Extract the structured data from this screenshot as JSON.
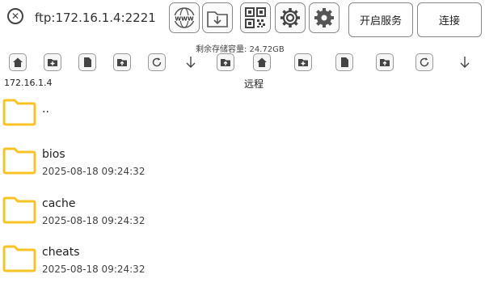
{
  "header": {
    "address": "ftp:172.16.1.4:2221",
    "start_service_label": "开启服务",
    "connect_label": "连接",
    "storage_text": "剩余存储容量: 24.72GB",
    "tool_icons": [
      "www-icon",
      "folder-download-icon",
      "qr-code-icon",
      "settings-outline-icon",
      "settings-filled-icon"
    ]
  },
  "local": {
    "label": "172.16.1.4"
  },
  "remote": {
    "label": "远程"
  },
  "files": [
    {
      "name": "..",
      "date": ""
    },
    {
      "name": "bios",
      "date": "2025-08-18 09:24:32"
    },
    {
      "name": "cache",
      "date": "2025-08-18 09:24:32"
    },
    {
      "name": "cheats",
      "date": "2025-08-18 09:24:32"
    }
  ],
  "colors": {
    "folder": "#F7C325",
    "folder_stroke": "#E0A800",
    "border": "#888888"
  }
}
